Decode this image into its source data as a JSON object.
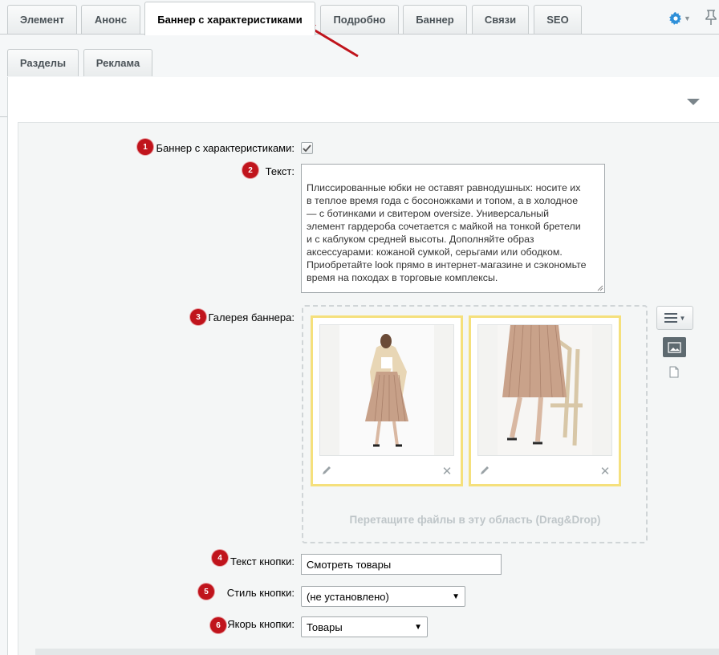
{
  "tabs": [
    {
      "label": "Элемент"
    },
    {
      "label": "Анонс"
    },
    {
      "label": "Баннер с характеристиками"
    },
    {
      "label": "Подробно"
    },
    {
      "label": "Баннер"
    },
    {
      "label": "Связи"
    },
    {
      "label": "SEO"
    }
  ],
  "subtabs": [
    {
      "label": "Разделы"
    },
    {
      "label": "Реклама"
    }
  ],
  "form": {
    "banner_label": "Баннер с характеристиками:",
    "banner_checked": true,
    "text_label": "Текст:",
    "text_value": "Плиссированные юбки не оставят равнодушных: носите их\nв теплое время года с босоножками и топом, а в холодное\n— с ботинками и свитером oversize. Универсальный\nэлемент гардероба сочетается с майкой на тонкой бретели\nи с каблуком средней высоты. Дополняйте образ\nаксессуарами: кожаной сумкой, серьгами или ободком.\nПриобретайте look прямо в интернет-магазине и сэкономьте\nвремя на походах в торговые комплексы.",
    "gallery_label": "Галерея баннера:",
    "drop_text": "Перетащите файлы в эту область (Drag&Drop)",
    "button_text_label": "Текст кнопки:",
    "button_text_value": "Смотреть товары",
    "button_style_label": "Стиль кнопки:",
    "button_style_value": "(не установлено)",
    "button_anchor_label": "Якорь кнопки:",
    "button_anchor_value": "Товары"
  },
  "badges": [
    "1",
    "2",
    "3",
    "4",
    "5",
    "6"
  ],
  "icons": {
    "settings": "gear-icon",
    "pin": "pin-icon",
    "edit": "pencil-icon",
    "delete": "close-icon",
    "menu": "hamburger-icon",
    "image": "image-icon",
    "file": "file-icon"
  },
  "colors": {
    "badge": "#c0141c",
    "thumb_border": "#f5e07c",
    "gear": "#2e8fd8",
    "annotation_arrow": "#c0141c"
  }
}
